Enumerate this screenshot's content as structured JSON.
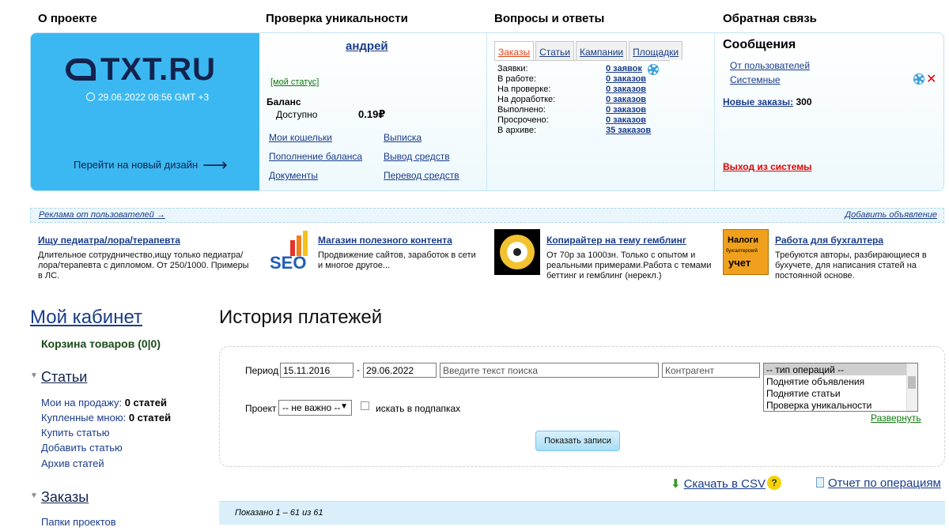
{
  "top_headers": [
    "О проекте",
    "Проверка уникальности",
    "Вопросы и ответы",
    "Обратная связь"
  ],
  "brand": {
    "logo": "TXT.RU",
    "datetime": "29.06.2022 08:56 GMT +3",
    "new_design": "Перейти на новый дизайн"
  },
  "account": {
    "username": "андрей",
    "my_status": "[мой статус]",
    "balance_label": "Баланс",
    "available_label": "Доступно",
    "available_value": "0.19₽",
    "links": [
      "Мои кошельки",
      "Выписка",
      "Пополнение баланса",
      "Вывод средств",
      "Документы",
      "Перевод средств"
    ]
  },
  "orders": {
    "tabs": [
      "Заказы",
      "Статьи",
      "Кампании",
      "Площадки"
    ],
    "active_tab": "Заказы",
    "rows": [
      {
        "label": "Заявки:",
        "value": "0 заявок"
      },
      {
        "label": "В работе:",
        "value": "0 заказов"
      },
      {
        "label": "На проверке:",
        "value": "0 заказов"
      },
      {
        "label": "На доработке:",
        "value": "0 заказов"
      },
      {
        "label": "Выполнено:",
        "value": "0 заказов"
      },
      {
        "label": "Просрочено:",
        "value": "0 заказов"
      },
      {
        "label": "В архиве:",
        "value": "35 заказов"
      }
    ]
  },
  "messages": {
    "title": "Сообщения",
    "from_users": "От пользователей",
    "system": "Системные",
    "new_orders_label": "Новые заказы:",
    "new_orders_count": "300",
    "logout": "Выход из системы"
  },
  "ads": {
    "label": "Реклама от пользователей →",
    "add": "Добавить объявление",
    "items": [
      {
        "title": "Ищу педиатра/лора/терапевта",
        "text": "Длительное сотрудничество,ищу только педиатра/лора/терапевта с дипломом. От 250/1000. Примеры в ЛС.",
        "image": "none"
      },
      {
        "title": "Магазин полезного контента",
        "text": "Продвижение сайтов, заработок в сети и многое другое...",
        "image": "seo-icon"
      },
      {
        "title": "Копирайтер на тему гемблинг",
        "text": "От 70р за 1000зн. Только с опытом и реальными примерами.Работа с темами беттинг и гемблинг (нерекл.)",
        "image": "soccer-ball-icon"
      },
      {
        "title": "Работа для бухгалтера",
        "text": "Требуются авторы, разбирающиеся в бухучете, для написания статей на постоянной основе.",
        "image": "tax-book-icon",
        "image_text": "Налоги бухгалтерский учет"
      }
    ]
  },
  "sidebar": {
    "title": "Мой кабинет",
    "cart": "Корзина товаров (0|0)",
    "articles_title": "Статьи",
    "articles": [
      {
        "label": "Мои на продажу:",
        "bold": "0 статей"
      },
      {
        "label": "Купленные мною:",
        "bold": "0 статей"
      },
      {
        "label": "Купить статью",
        "bold": ""
      },
      {
        "label": "Добавить статью",
        "bold": ""
      },
      {
        "label": "Архив статей",
        "bold": ""
      }
    ],
    "orders_title": "Заказы",
    "orders_items": [
      "Папки проектов"
    ]
  },
  "main": {
    "title": "История платежей",
    "period_label": "Период",
    "date_from": "15.11.2016",
    "dash": "-",
    "date_to": "29.06.2022",
    "search_placeholder": "Введите текст поиска",
    "contractor_placeholder": "Контрагент",
    "op_types": [
      "-- тип операций --",
      "Поднятие объявления",
      "Поднятие статьи",
      "Проверка уникальности"
    ],
    "project_label": "Проект",
    "project_value": "-- не важно --",
    "subfolders_label": "искать в подпапках",
    "expand": "Развернуть",
    "show_button": "Показать записи",
    "csv": "Скачать в CSV",
    "help": "?",
    "report": "Отчет по операциям",
    "shown": "Показано 1 – 61 из 61"
  },
  "colors": {
    "brand_blue": "#3bb8f1",
    "link": "#1a3c8a",
    "logout": "#e00000"
  }
}
